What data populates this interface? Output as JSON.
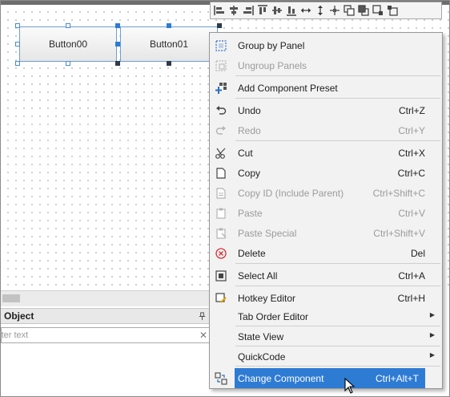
{
  "canvas": {
    "buttons": [
      {
        "label": "Button00"
      },
      {
        "label": "Button01"
      }
    ]
  },
  "toolbar": {
    "tools": [
      {
        "icon": "align-left-icon"
      },
      {
        "icon": "align-center-icon"
      },
      {
        "icon": "align-right-icon"
      },
      {
        "icon": "align-top-icon"
      },
      {
        "icon": "align-middle-icon"
      },
      {
        "icon": "align-bottom-icon"
      },
      {
        "icon": "distribute-horizontal-icon"
      },
      {
        "icon": "distribute-vertical-icon"
      },
      {
        "icon": "center-both-icon"
      },
      {
        "icon": "bring-forward-icon"
      },
      {
        "icon": "send-backward-icon"
      },
      {
        "icon": "bring-to-front-icon"
      },
      {
        "icon": "send-to-back-icon"
      }
    ]
  },
  "object_panel": {
    "title": "Object",
    "search_placeholder": "Filter text",
    "search_value": ""
  },
  "context_menu": {
    "items": [
      {
        "label": "Group by Panel",
        "shortcut": "",
        "icon": "group-panel-icon",
        "disabled": false,
        "submenu": false
      },
      {
        "label": "Ungroup Panels",
        "shortcut": "",
        "icon": "ungroup-panel-icon",
        "disabled": true,
        "submenu": false
      },
      {
        "label": "Add Component Preset",
        "shortcut": "",
        "icon": "add-preset-icon",
        "disabled": false,
        "submenu": false
      },
      {
        "label": "Undo",
        "shortcut": "Ctrl+Z",
        "icon": "undo-icon",
        "disabled": false,
        "submenu": false
      },
      {
        "label": "Redo",
        "shortcut": "Ctrl+Y",
        "icon": "redo-icon",
        "disabled": true,
        "submenu": false
      },
      {
        "label": "Cut",
        "shortcut": "Ctrl+X",
        "icon": "cut-icon",
        "disabled": false,
        "submenu": false
      },
      {
        "label": "Copy",
        "shortcut": "Ctrl+C",
        "icon": "copy-icon",
        "disabled": false,
        "submenu": false
      },
      {
        "label": "Copy ID (Include Parent)",
        "shortcut": "Ctrl+Shift+C",
        "icon": "copy-id-icon",
        "disabled": true,
        "submenu": false
      },
      {
        "label": "Paste",
        "shortcut": "Ctrl+V",
        "icon": "paste-icon",
        "disabled": true,
        "submenu": false
      },
      {
        "label": "Paste Special",
        "shortcut": "Ctrl+Shift+V",
        "icon": "paste-special-icon",
        "disabled": true,
        "submenu": false
      },
      {
        "label": "Delete",
        "shortcut": "Del",
        "icon": "delete-icon",
        "disabled": false,
        "submenu": false
      },
      {
        "label": "Select All",
        "shortcut": "Ctrl+A",
        "icon": "select-all-icon",
        "disabled": false,
        "submenu": false
      },
      {
        "label": "Hotkey Editor",
        "shortcut": "Ctrl+H",
        "icon": "hotkey-editor-icon",
        "disabled": false,
        "submenu": false
      },
      {
        "label": "Tab Order Editor",
        "shortcut": "",
        "icon": "",
        "disabled": false,
        "submenu": true
      },
      {
        "label": "State View",
        "shortcut": "",
        "icon": "",
        "disabled": false,
        "submenu": true
      },
      {
        "label": "QuickCode",
        "shortcut": "",
        "icon": "",
        "disabled": false,
        "submenu": true
      },
      {
        "label": "Change Component",
        "shortcut": "Ctrl+Alt+T",
        "icon": "change-component-icon",
        "disabled": false,
        "submenu": false,
        "highlighted": true
      }
    ]
  },
  "colors": {
    "highlight": "#2e7bd4",
    "selection_handle": "#2d7bd6",
    "delete_icon": "#d13438",
    "menu_background": "#f2f2f2"
  }
}
